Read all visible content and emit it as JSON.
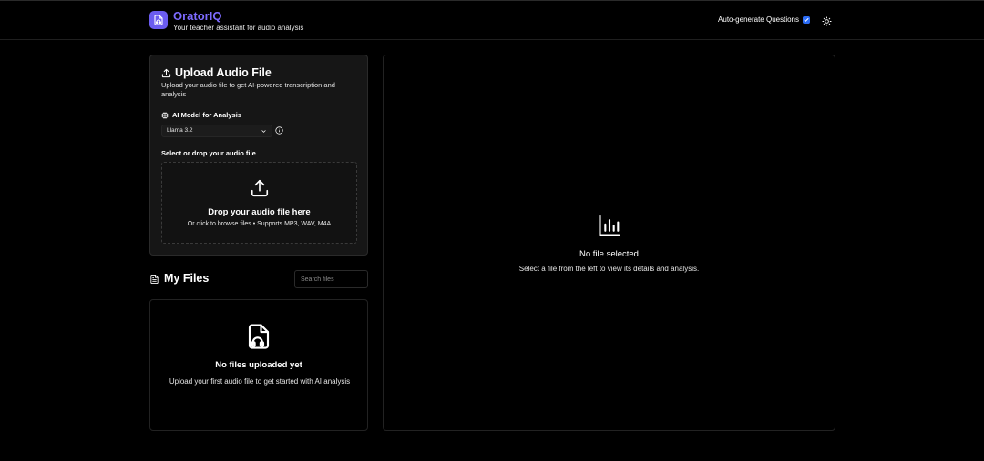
{
  "header": {
    "brand_name": "OratorIQ",
    "tagline": "Your teacher assistant for audio analysis",
    "auto_generate_label": "Auto-generate Questions",
    "auto_generate_checked": true,
    "accent_color": "#7d6bff",
    "logo_bg_color": "#6b5cf0",
    "logo_icon": "file-audio-icon",
    "theme_icon": "sun-icon"
  },
  "upload": {
    "title": "Upload Audio File",
    "title_icon": "upload-icon",
    "description": "Upload your audio file to get AI-powered transcription and analysis",
    "model_label": "AI Model for Analysis",
    "model_label_icon": "cpu-icon",
    "model_selected": "Llama 3.2",
    "info_icon": "info-icon",
    "select_label": "Select or drop your audio file",
    "dropzone_title": "Drop your audio file here",
    "dropzone_subtitle": "Or click to browse files • Supports MP3, WAV, M4A",
    "dropzone_icon": "upload-icon"
  },
  "files": {
    "title": "My Files",
    "title_icon": "file-text-icon",
    "search_placeholder": "Search files",
    "empty_title": "No files uploaded yet",
    "empty_subtitle": "Upload your first audio file to get started with AI analysis",
    "empty_icon": "file-audio-icon"
  },
  "details": {
    "empty_title": "No file selected",
    "empty_subtitle": "Select a file from the left to view its details and analysis.",
    "empty_icon": "bar-chart-icon"
  }
}
